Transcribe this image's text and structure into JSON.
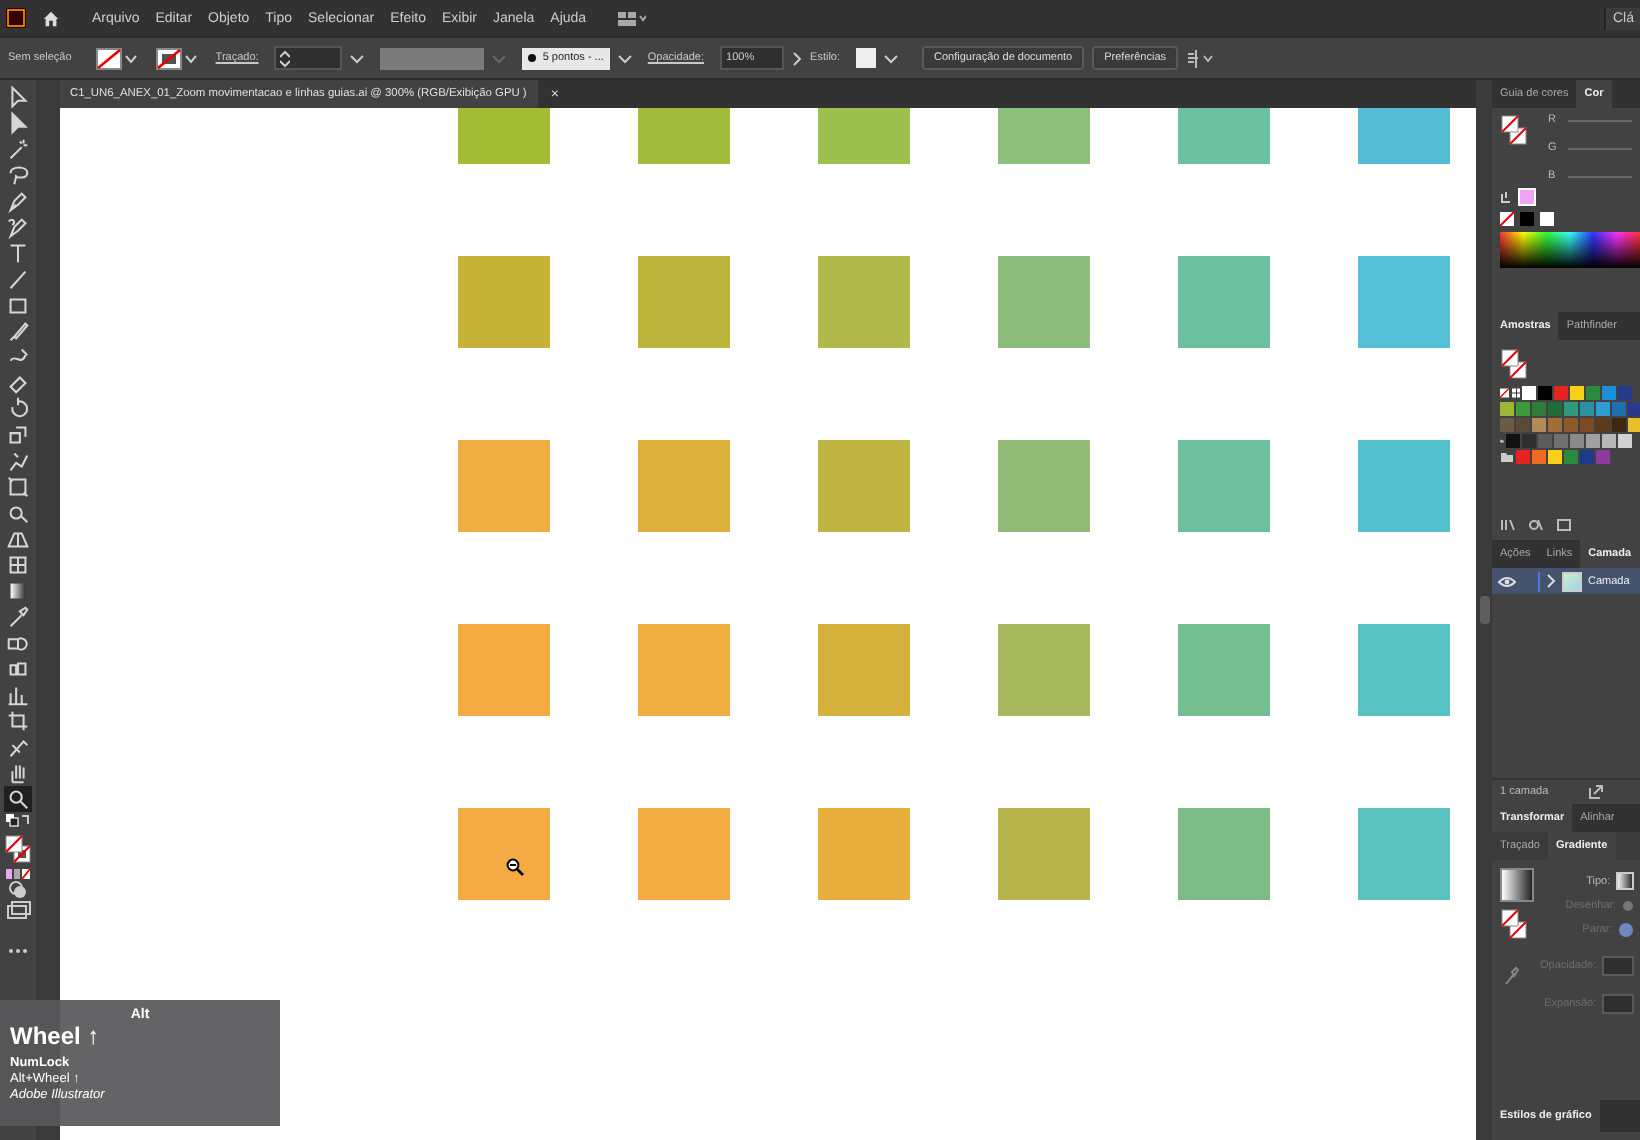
{
  "menu_bar": {
    "items": [
      "Arquivo",
      "Editar",
      "Objeto",
      "Tipo",
      "Selecionar",
      "Efeito",
      "Exibir",
      "Janela",
      "Ajuda"
    ],
    "workspace": "Clá"
  },
  "control_bar": {
    "selection": "Sem seleção",
    "stroke_label": "Traçado:",
    "brush": "5 pontos - ...",
    "opacity_label": "Opacidade:",
    "opacity": "100%",
    "style_label": "Estilo:",
    "buttons": [
      "Configuração de documento",
      "Preferências"
    ]
  },
  "document_tab": {
    "title": "C1_UN6_ANEX_01_Zoom movimentacao e linhas guias.ai @ 300% (RGB/Exibição GPU )",
    "close": "×"
  },
  "tools": [
    {
      "kind": "select",
      "selected": false
    },
    {
      "kind": "direct",
      "selected": false
    },
    {
      "kind": "wand",
      "selected": false
    },
    {
      "kind": "lasso",
      "selected": false
    },
    {
      "kind": "pen",
      "selected": false
    },
    {
      "kind": "curvature",
      "selected": false
    },
    {
      "kind": "type",
      "selected": false
    },
    {
      "kind": "line",
      "selected": false
    },
    {
      "kind": "rect",
      "selected": false
    },
    {
      "kind": "brush",
      "selected": false
    },
    {
      "kind": "shaper",
      "selected": false
    },
    {
      "kind": "eraser",
      "selected": false
    },
    {
      "kind": "rotate",
      "selected": false
    },
    {
      "kind": "scale",
      "selected": false
    },
    {
      "kind": "warp",
      "selected": false
    },
    {
      "kind": "freetransform",
      "selected": false
    },
    {
      "kind": "shapebuilder",
      "selected": false
    },
    {
      "kind": "perspective",
      "selected": false
    },
    {
      "kind": "mesh",
      "selected": false
    },
    {
      "kind": "gradient",
      "selected": false
    },
    {
      "kind": "eyedropper",
      "selected": false
    },
    {
      "kind": "blend",
      "selected": false
    },
    {
      "kind": "symbol",
      "selected": false
    },
    {
      "kind": "graph",
      "selected": false
    },
    {
      "kind": "artboard",
      "selected": false
    },
    {
      "kind": "slice",
      "selected": false
    },
    {
      "kind": "hand",
      "selected": false
    },
    {
      "kind": "zoom",
      "selected": true
    }
  ],
  "canvas": {
    "rows": [
      {
        "squares": [
          {
            "color": "#a4bb35"
          },
          {
            "color": "#a2bd3b"
          },
          {
            "color": "#9cbf4e"
          },
          {
            "color": "#8dc07a"
          },
          {
            "color": "#6cc1a2"
          },
          {
            "color": "#55bcd5"
          }
        ]
      },
      {
        "squares": [
          {
            "color": "#c6b236"
          },
          {
            "color": "#bdb53c"
          },
          {
            "color": "#b0b94a"
          },
          {
            "color": "#8dbd7c"
          },
          {
            "color": "#6cc0a0"
          },
          {
            "color": "#56c0d8"
          }
        ]
      },
      {
        "squares": [
          {
            "color": "#f0ae42"
          },
          {
            "color": "#dcb03a"
          },
          {
            "color": "#c0b443"
          },
          {
            "color": "#93bb78"
          },
          {
            "color": "#6dbf9d"
          },
          {
            "color": "#54c1cf"
          }
        ]
      },
      {
        "squares": [
          {
            "color": "#f4ac42"
          },
          {
            "color": "#efae3f"
          },
          {
            "color": "#d4b13a"
          },
          {
            "color": "#a7b95c"
          },
          {
            "color": "#75be92"
          },
          {
            "color": "#57c3c3"
          }
        ]
      },
      {
        "squares": [
          {
            "color": "#f4ab43"
          },
          {
            "color": "#f3ac41"
          },
          {
            "color": "#e8ae3c"
          },
          {
            "color": "#b7b54c"
          },
          {
            "color": "#7dbc86"
          },
          {
            "color": "#5cc2bf"
          }
        ]
      }
    ]
  },
  "key_overlay": {
    "modifier": "Alt",
    "action": "Wheel ↑",
    "lock": "NumLock",
    "combo": "Alt+Wheel ↑",
    "app": "Adobe Illustrator"
  },
  "color_panel": {
    "tabs": [
      {
        "label": "Guia de cores",
        "selected": false
      },
      {
        "label": "Cor",
        "selected": true
      }
    ],
    "channels": [
      "R",
      "G",
      "B"
    ]
  },
  "swatches_panel": {
    "tabs": [
      {
        "label": "Amostras",
        "selected": true
      },
      {
        "label": "Pathfinder",
        "selected": false
      }
    ],
    "rows": [
      {
        "kind": "plain",
        "swatches": [
          {
            "color": "#ffffff"
          },
          {
            "color": "#000000"
          },
          {
            "color": "#e52421"
          },
          {
            "color": "#f7d117"
          },
          {
            "color": "#2b8a3e"
          },
          {
            "color": "#1c8fd8"
          },
          {
            "color": "#253a8d"
          }
        ]
      },
      {
        "kind": "plain",
        "swatches": [
          {
            "color": "#9cb833"
          },
          {
            "color": "#3d9a3a"
          },
          {
            "color": "#2e7d3a"
          },
          {
            "color": "#1f6b3a"
          },
          {
            "color": "#2c9b7e"
          },
          {
            "color": "#2a92a3"
          },
          {
            "color": "#2e9bd6"
          },
          {
            "color": "#1f6fb4"
          },
          {
            "color": "#2b3a8c"
          }
        ]
      },
      {
        "kind": "plain",
        "swatches": [
          {
            "color": "#6b5a44"
          },
          {
            "color": "#5a4a37"
          },
          {
            "color": "#b58b55"
          },
          {
            "color": "#a06e3b"
          },
          {
            "color": "#8b5a2b"
          },
          {
            "color": "#7a4a22"
          },
          {
            "color": "#5d3a1a"
          },
          {
            "color": "#3d2712"
          },
          {
            "color": "#e8c02a"
          }
        ]
      },
      {
        "kind": "group",
        "swatches": [
          {
            "color": "#111111"
          },
          {
            "color": "#2e2e2e"
          },
          {
            "color": "#5c5c5c"
          },
          {
            "color": "#707070"
          },
          {
            "color": "#8a8a8a"
          },
          {
            "color": "#a0a0a0"
          },
          {
            "color": "#b8b8b8"
          },
          {
            "color": "#d0d0d0"
          }
        ]
      },
      {
        "kind": "group",
        "swatches": [
          {
            "color": "#e52421"
          },
          {
            "color": "#f06a23"
          },
          {
            "color": "#f7d117"
          },
          {
            "color": "#2b8a3e"
          },
          {
            "color": "#1c3a8c"
          },
          {
            "color": "#8c3a9c"
          }
        ]
      }
    ]
  },
  "layers_panel": {
    "tabs": [
      {
        "label": "Ações",
        "selected": false
      },
      {
        "label": "Links",
        "selected": false
      },
      {
        "label": "Camada",
        "selected": true
      }
    ],
    "layers": [
      {
        "name": "Camada",
        "visible": true
      }
    ],
    "count": "1 camada"
  },
  "transform_panel": {
    "tabs": [
      {
        "label": "Transformar",
        "selected": true
      },
      {
        "label": "Alinhar",
        "selected": false
      }
    ]
  },
  "gradient_panel": {
    "tabs": [
      {
        "label": "Traçado",
        "selected": false
      },
      {
        "label": "Gradiente",
        "selected": true
      }
    ],
    "fields": [
      {
        "kind": "type",
        "label": "Tipo:",
        "disabled": false
      },
      {
        "kind": "radio",
        "label": "Desenhar:",
        "disabled": true
      },
      {
        "kind": "stop",
        "label": "Parar:",
        "disabled": true
      },
      {
        "kind": "input",
        "label": "Opacidade:",
        "disabled": true
      },
      {
        "kind": "input",
        "label": "Expansão:",
        "disabled": true
      }
    ]
  },
  "graphic_styles_panel": {
    "title": "Estilos de gráfico"
  }
}
